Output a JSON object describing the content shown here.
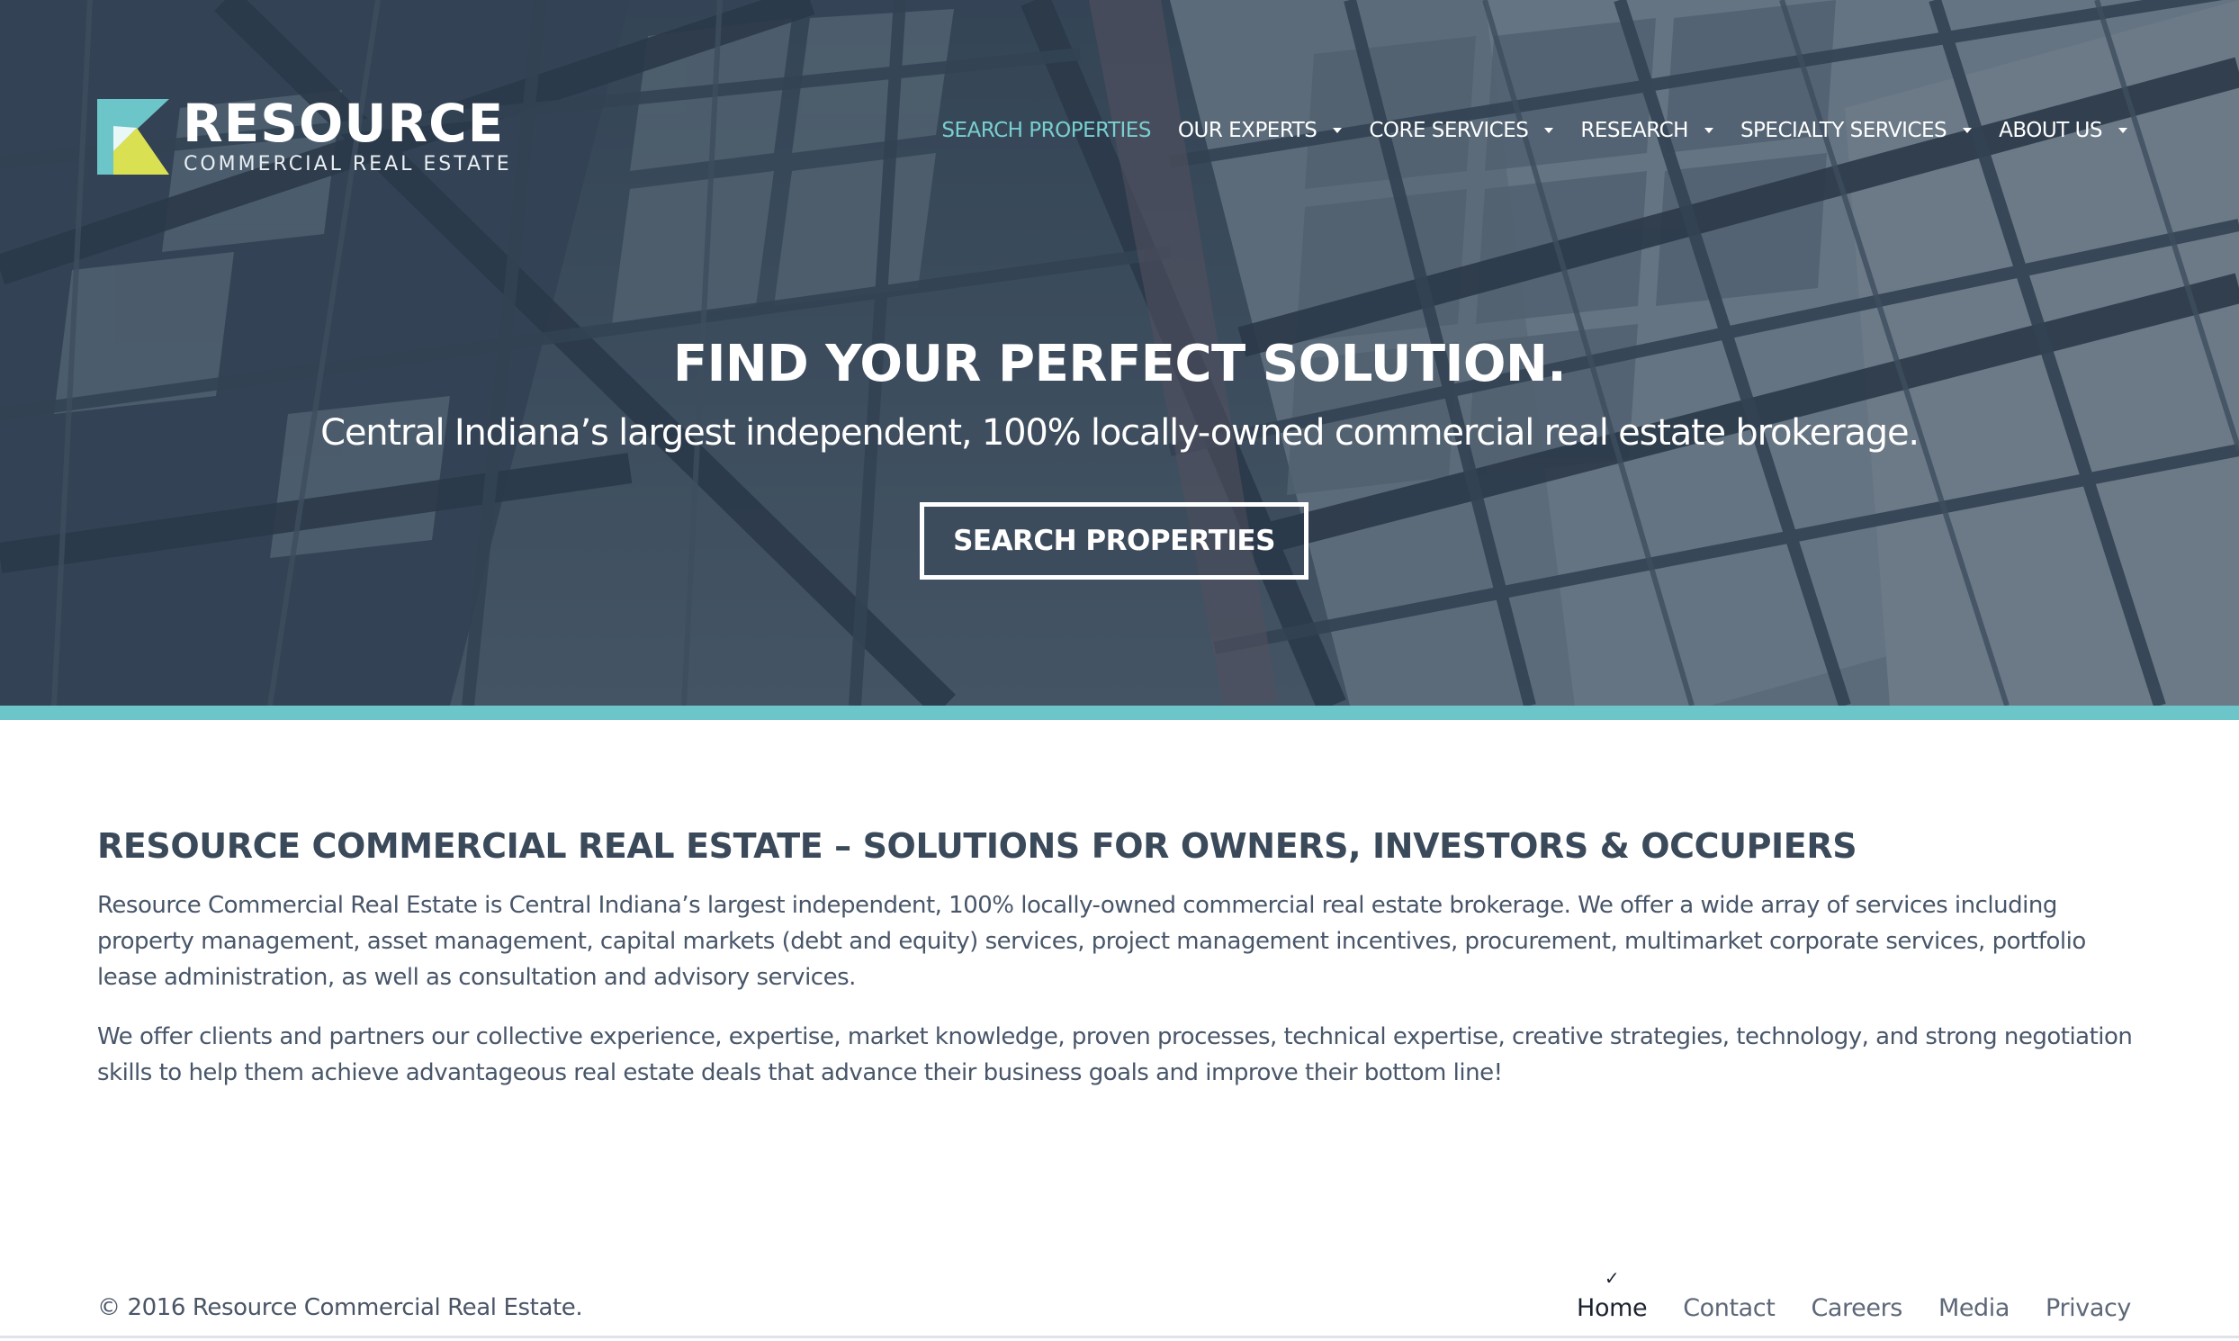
{
  "brand": {
    "name": "RESOURCE",
    "tagline": "COMMERCIAL REAL ESTATE",
    "colors": {
      "teal": "#6cc5c8",
      "lime": "#d9e052",
      "navy": "#3b4a5a"
    }
  },
  "nav": {
    "items": [
      {
        "label": "SEARCH PROPERTIES",
        "active": true,
        "dropdown": false
      },
      {
        "label": "OUR EXPERTS",
        "active": false,
        "dropdown": true
      },
      {
        "label": "CORE SERVICES",
        "active": false,
        "dropdown": true
      },
      {
        "label": "RESEARCH",
        "active": false,
        "dropdown": true
      },
      {
        "label": "SPECIALTY SERVICES",
        "active": false,
        "dropdown": true
      },
      {
        "label": "ABOUT US",
        "active": false,
        "dropdown": true
      }
    ]
  },
  "hero": {
    "title": "FIND YOUR PERFECT SOLUTION.",
    "subtitle": "Central Indiana’s largest independent, 100% locally-owned commercial real estate brokerage.",
    "button_label": "SEARCH PROPERTIES"
  },
  "content": {
    "heading": "RESOURCE COMMERCIAL REAL ESTATE – SOLUTIONS FOR OWNERS, INVESTORS & OCCUPIERS",
    "paragraphs": [
      "Resource Commercial Real Estate is Central Indiana’s largest independent, 100% locally-owned commercial real estate brokerage. We offer a wide array of services including property management, asset management, capital markets (debt and equity) services, project management incentives, procurement, multimarket corporate services, portfolio lease administration, as well as consultation and advisory services.",
      "We offer clients and partners our collective experience, expertise, market knowledge, proven processes, technical expertise, creative strategies, technology, and strong negotiation skills to help them achieve advantageous real estate deals that advance their business goals and improve their bottom line!"
    ]
  },
  "footer": {
    "copyright": "© 2016 Resource Commercial Real Estate.",
    "check_glyph": "✓",
    "links": [
      {
        "label": "Home",
        "current": true
      },
      {
        "label": "Contact",
        "current": false
      },
      {
        "label": "Careers",
        "current": false
      },
      {
        "label": "Media",
        "current": false
      },
      {
        "label": "Privacy",
        "current": false
      }
    ]
  }
}
